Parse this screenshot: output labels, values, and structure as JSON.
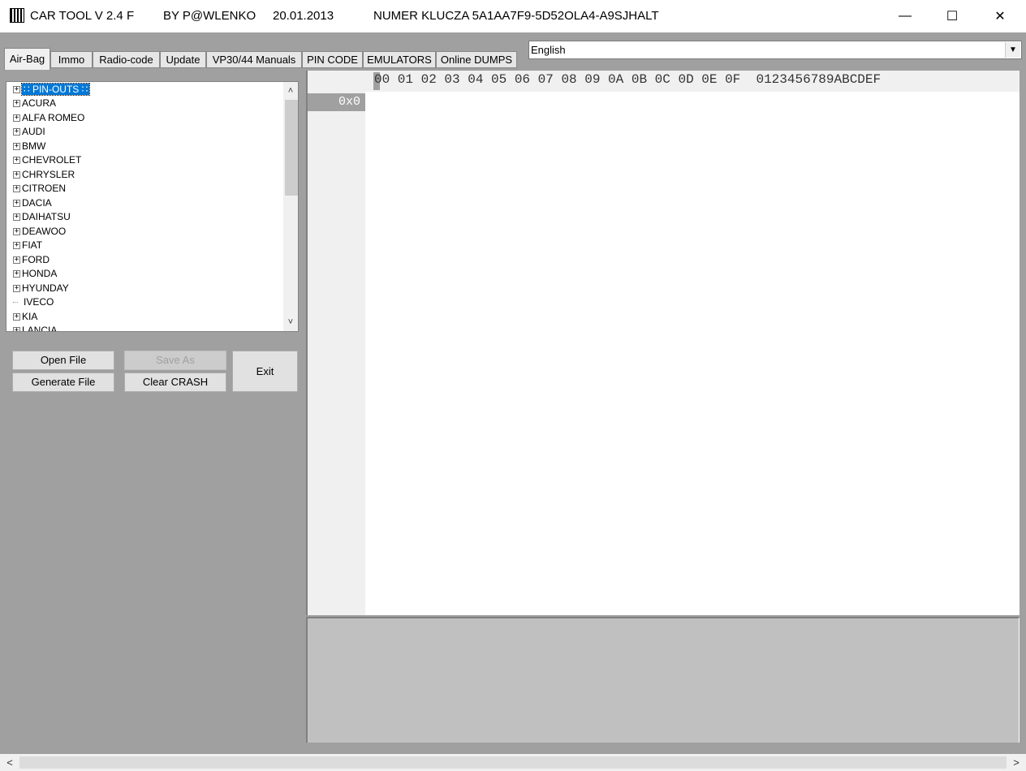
{
  "window": {
    "app_name": "CAR TOOL V 2.4 F",
    "author": "BY P@WLENKO",
    "date": "20.01.2013",
    "key": "NUMER KLUCZA 5A1AA7F9-5D52OLA4-A9SJHALT",
    "minimize": "—",
    "maximize": "☐",
    "close": "✕"
  },
  "tabs": [
    {
      "label": "Air-Bag",
      "active": true
    },
    {
      "label": "Immo"
    },
    {
      "label": "Radio-code"
    },
    {
      "label": "Update"
    },
    {
      "label": "VP30/44 Manuals"
    },
    {
      "label": "PIN CODE"
    },
    {
      "label": "EMULATORS"
    },
    {
      "label": "Online DUMPS"
    }
  ],
  "language": {
    "selected": "English",
    "arrow": "▼"
  },
  "tree": {
    "items": [
      {
        "label": "PIN-OUTS",
        "expandable": true,
        "selected": true
      },
      {
        "label": "ACURA",
        "expandable": true
      },
      {
        "label": "ALFA ROMEO",
        "expandable": true
      },
      {
        "label": "AUDI",
        "expandable": true
      },
      {
        "label": "BMW",
        "expandable": true
      },
      {
        "label": "CHEVROLET",
        "expandable": true
      },
      {
        "label": "CHRYSLER",
        "expandable": true
      },
      {
        "label": "CITROEN",
        "expandable": true
      },
      {
        "label": "DACIA",
        "expandable": true
      },
      {
        "label": "DAIHATSU",
        "expandable": true
      },
      {
        "label": "DEAWOO",
        "expandable": true
      },
      {
        "label": "FIAT",
        "expandable": true
      },
      {
        "label": "FORD",
        "expandable": true
      },
      {
        "label": "HONDA",
        "expandable": true
      },
      {
        "label": "HYUNDAY",
        "expandable": true
      },
      {
        "label": "IVECO",
        "expandable": false
      },
      {
        "label": "KIA",
        "expandable": true
      },
      {
        "label": "LANCIA",
        "expandable": true
      }
    ],
    "scroll_up": "˄",
    "scroll_down": "˅"
  },
  "buttons": {
    "open_file": "Open File",
    "save_as": "Save As",
    "exit": "Exit",
    "generate_file": "Generate File",
    "clear_crash": "Clear CRASH"
  },
  "hex": {
    "columns": "00 01 02 03 04 05 06 07 08 09 0A 0B 0C 0D 0E 0F  0123456789ABCDEF",
    "offset": "0x0"
  },
  "hscroll": {
    "left": "<",
    "right": ">"
  }
}
